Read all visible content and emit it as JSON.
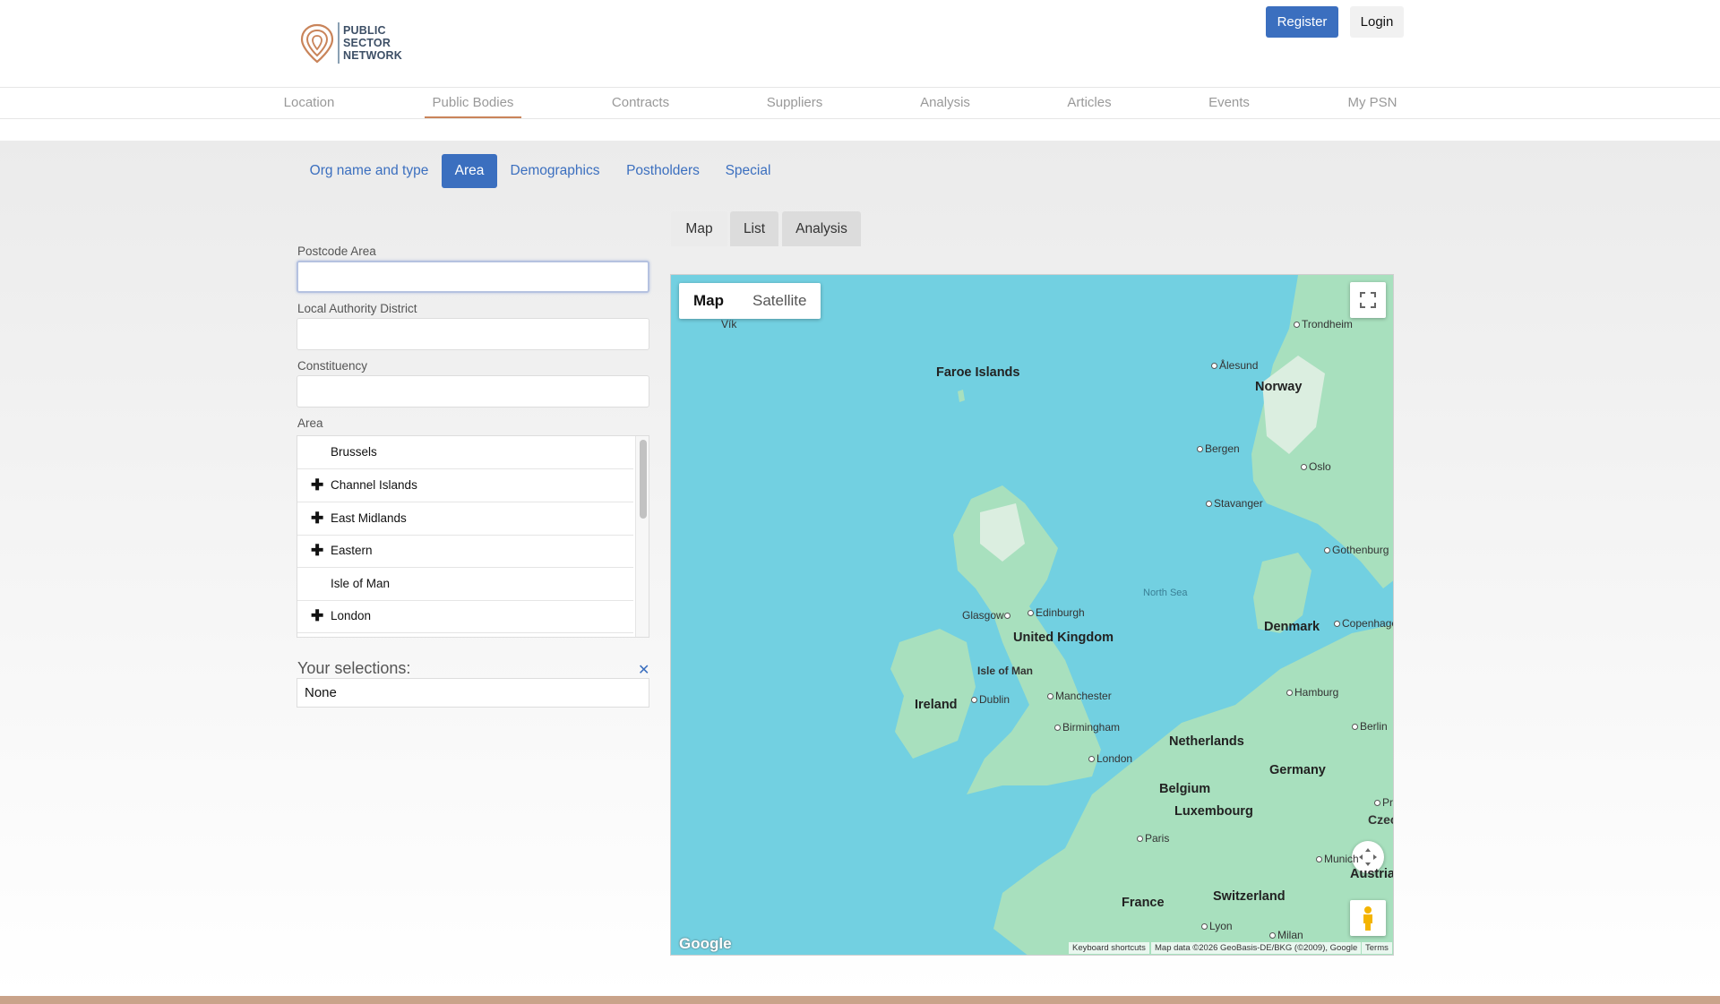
{
  "header": {
    "logo_lines": [
      "PUBLIC",
      "SECTOR",
      "NETWORK"
    ],
    "register_label": "Register",
    "login_label": "Login"
  },
  "mainnav": {
    "items": [
      "Location",
      "Public Bodies",
      "Contracts",
      "Suppliers",
      "Analysis",
      "Articles",
      "Events",
      "My PSN"
    ],
    "active": "Public Bodies"
  },
  "subtabs": {
    "items": [
      "Org name and type",
      "Area",
      "Demographics",
      "Postholders",
      "Special"
    ],
    "active": "Area"
  },
  "form": {
    "postcode_label": "Postcode Area",
    "postcode_value": "",
    "lad_label": "Local Authority District",
    "lad_value": "",
    "constituency_label": "Constituency",
    "constituency_value": "",
    "area_label": "Area",
    "area_items": [
      {
        "label": "Brussels",
        "expandable": false
      },
      {
        "label": "Channel Islands",
        "expandable": true
      },
      {
        "label": "East Midlands",
        "expandable": true
      },
      {
        "label": "Eastern",
        "expandable": true
      },
      {
        "label": "Isle of Man",
        "expandable": false
      },
      {
        "label": "London",
        "expandable": true
      }
    ],
    "expand_symbol": "✚"
  },
  "selections": {
    "title": "Your selections:",
    "clear_symbol": "✕",
    "value": "None"
  },
  "viewtabs": {
    "items": [
      "Map",
      "List",
      "Analysis"
    ],
    "active": "Map"
  },
  "map": {
    "type_map": "Map",
    "type_satellite": "Satellite",
    "countries": [
      "Faroe Islands",
      "Norway",
      "United Kingdom",
      "Ireland",
      "Denmark",
      "Netherlands",
      "Germany",
      "Belgium",
      "Luxembourg",
      "France",
      "Switzerland",
      "Austria"
    ],
    "cities": [
      "Trondheim",
      "Ålesund",
      "Bergen",
      "Oslo",
      "Stavanger",
      "Gothenburg",
      "Glasgow",
      "Edinburgh",
      "Isle of Man",
      "Manchester",
      "Dublin",
      "Birmingham",
      "London",
      "Hamburg",
      "Berlin",
      "Copenhagen",
      "Paris",
      "Lyon",
      "Milan",
      "Munich",
      "Prague",
      "Czec",
      "Vík"
    ],
    "sea": "North Sea",
    "footer_shortcuts": "Keyboard shortcuts",
    "footer_data": "Map data ©2026 GeoBasis-DE/BKG (©2009), Google",
    "footer_terms": "Terms",
    "google": "Google",
    "colors": {
      "water": "#72d0e1",
      "land": "#a8e0be",
      "land_dark": "#8fd3ab"
    }
  }
}
